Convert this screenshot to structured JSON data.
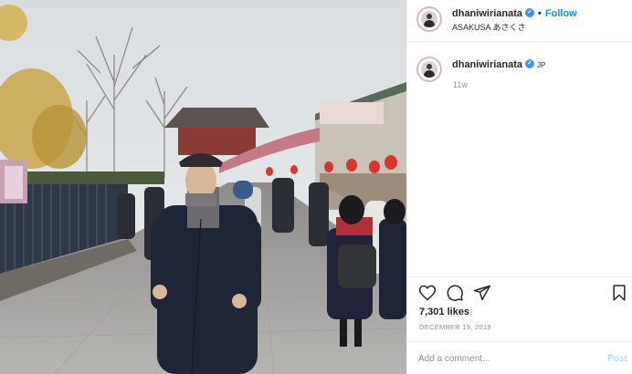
{
  "post": {
    "username": "dhaniwirianata",
    "follow_label": "Follow",
    "dot": "•",
    "more_icon": "more-horizontal-icon",
    "location": "ASAKUSA あさくさ"
  },
  "caption": {
    "username": "dhaniwirianata",
    "country": "JP",
    "time": "11w"
  },
  "actions": {
    "icons": [
      "heart-icon",
      "comment-icon",
      "share-icon",
      "bookmark-icon"
    ]
  },
  "stats": {
    "likes": "7,301 likes",
    "date": "DECEMBER 19, 2019"
  },
  "comment": {
    "placeholder": "Add a comment...",
    "post_label": "Post"
  },
  "colors": {
    "accent": "#0095f6",
    "verified": "#3897f0",
    "post_disabled": "#b2dffc"
  }
}
